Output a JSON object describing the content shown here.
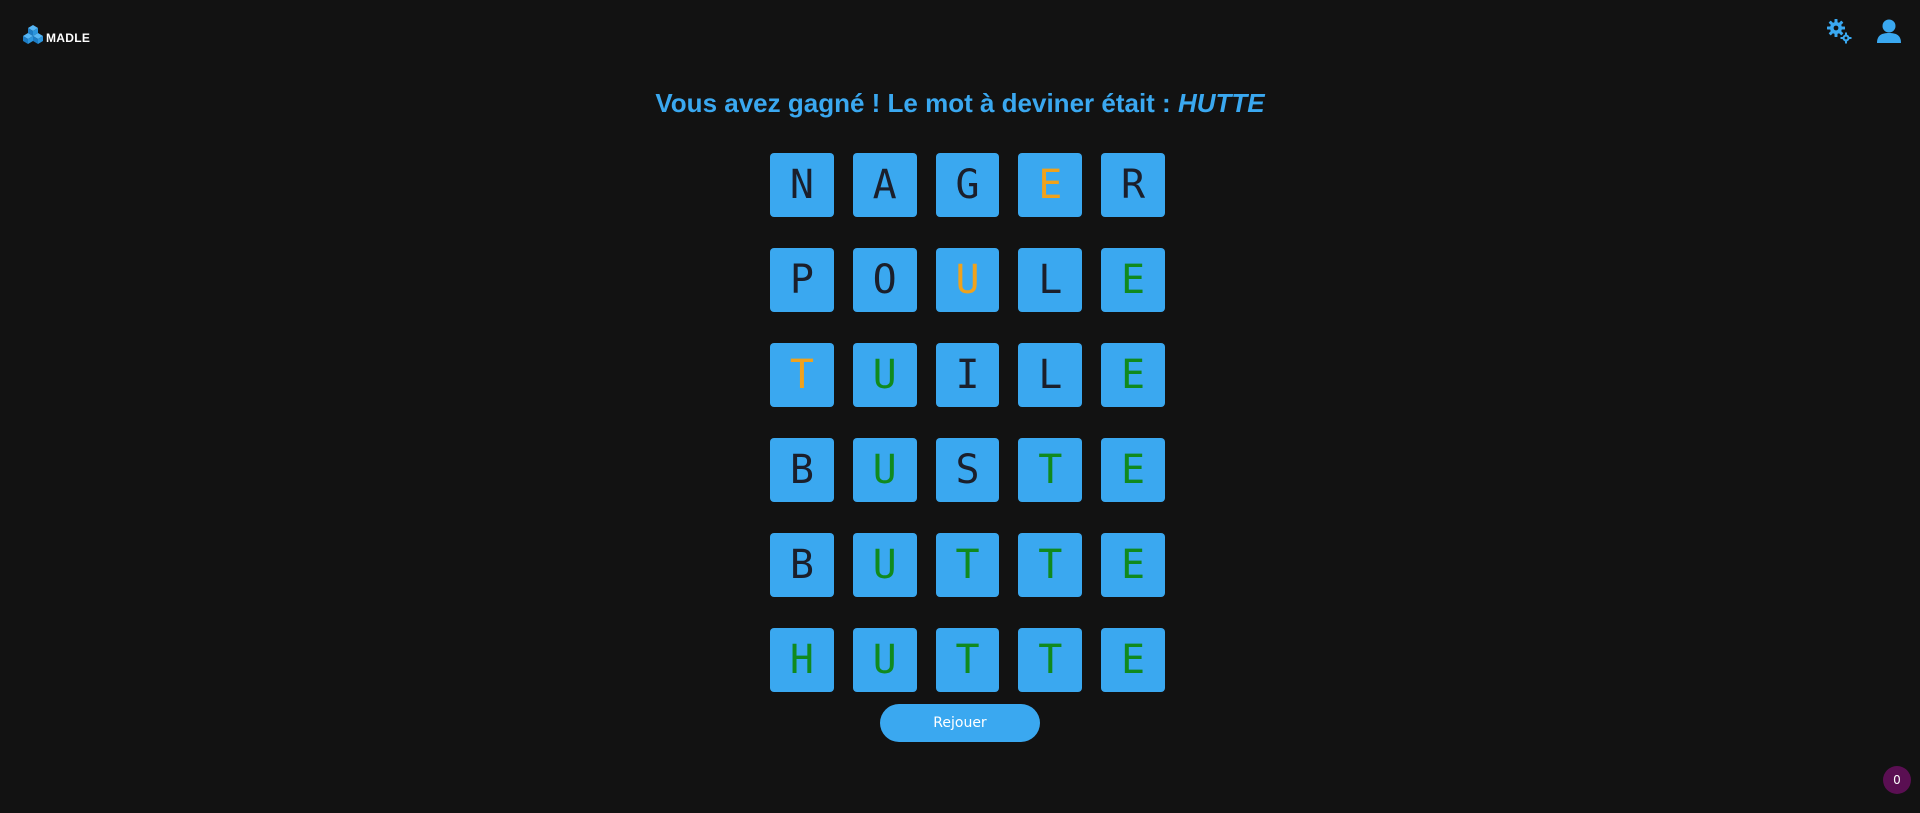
{
  "header": {
    "logo_text": "MADLE",
    "settings_icon": "gears-icon",
    "profile_icon": "user-icon"
  },
  "result": {
    "message": "Vous avez gagné ! Le mot à deviner était : ",
    "word": "HUTTE"
  },
  "board": {
    "rows": [
      [
        {
          "letter": "N",
          "state": "absent"
        },
        {
          "letter": "A",
          "state": "absent"
        },
        {
          "letter": "G",
          "state": "absent"
        },
        {
          "letter": "E",
          "state": "present"
        },
        {
          "letter": "R",
          "state": "absent"
        }
      ],
      [
        {
          "letter": "P",
          "state": "absent"
        },
        {
          "letter": "O",
          "state": "absent"
        },
        {
          "letter": "U",
          "state": "present"
        },
        {
          "letter": "L",
          "state": "absent"
        },
        {
          "letter": "E",
          "state": "correct"
        }
      ],
      [
        {
          "letter": "T",
          "state": "present"
        },
        {
          "letter": "U",
          "state": "correct"
        },
        {
          "letter": "I",
          "state": "absent"
        },
        {
          "letter": "L",
          "state": "absent"
        },
        {
          "letter": "E",
          "state": "correct"
        }
      ],
      [
        {
          "letter": "B",
          "state": "absent"
        },
        {
          "letter": "U",
          "state": "correct"
        },
        {
          "letter": "S",
          "state": "absent"
        },
        {
          "letter": "T",
          "state": "correct"
        },
        {
          "letter": "E",
          "state": "correct"
        }
      ],
      [
        {
          "letter": "B",
          "state": "absent"
        },
        {
          "letter": "U",
          "state": "correct"
        },
        {
          "letter": "T",
          "state": "correct"
        },
        {
          "letter": "T",
          "state": "correct"
        },
        {
          "letter": "E",
          "state": "correct"
        }
      ],
      [
        {
          "letter": "H",
          "state": "correct"
        },
        {
          "letter": "U",
          "state": "correct"
        },
        {
          "letter": "T",
          "state": "correct"
        },
        {
          "letter": "T",
          "state": "correct"
        },
        {
          "letter": "E",
          "state": "correct"
        }
      ]
    ]
  },
  "actions": {
    "replay_label": "Rejouer"
  },
  "badge": {
    "count": "0"
  },
  "colors": {
    "background": "#121212",
    "accent": "#3aa8f0",
    "tile_correct_text": "#108a1e",
    "tile_present_text": "#f0a21c",
    "tile_absent_text": "#1b1f2b",
    "badge": "#5a0f52"
  }
}
